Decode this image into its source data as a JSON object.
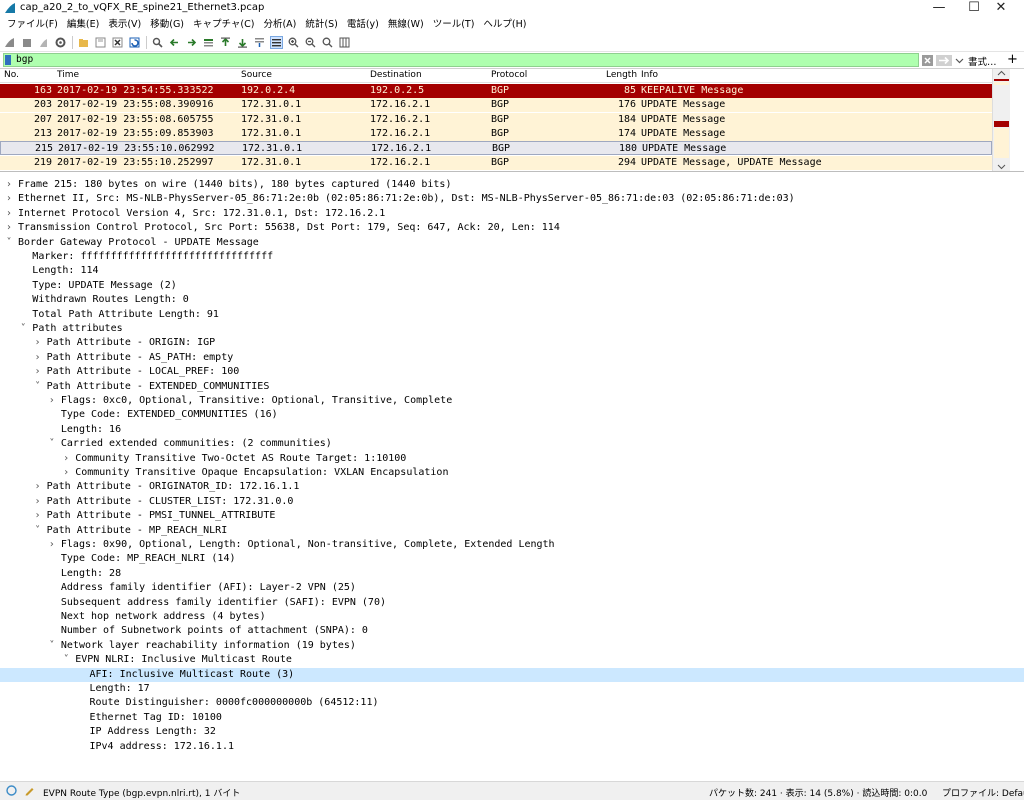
{
  "window": {
    "title": "cap_a20_2_to_vQFX_RE_spine21_Ethernet3.pcap",
    "minimize": "—",
    "maximize": "☐",
    "close": "✕"
  },
  "menu": [
    "ファイル(F)",
    "編集(E)",
    "表示(V)",
    "移動(G)",
    "キャプチャ(C)",
    "分析(A)",
    "統計(S)",
    "電話(y)",
    "無線(W)",
    "ツール(T)",
    "ヘルプ(H)"
  ],
  "toolbar": {
    "icons": [
      "shark-fin-icon",
      "stop-icon",
      "restart-icon",
      "options-gear-icon",
      "open-folder-icon",
      "save-icon",
      "close-file-icon",
      "reload-icon",
      "find-icon",
      "back-arrow-icon",
      "forward-arrow-icon",
      "goto-packet-icon",
      "first-packet-icon",
      "last-packet-icon",
      "autoscroll-icon",
      "colorize-icon",
      "zoom-in-icon",
      "zoom-out-icon",
      "normal-size-icon",
      "resize-columns-icon"
    ]
  },
  "filter": {
    "value": "bgp",
    "expression_label": "書式…",
    "add_label": "+"
  },
  "packet_list": {
    "columns": [
      "No.",
      "Time",
      "Source",
      "Destination",
      "Protocol",
      "Length",
      "Info"
    ],
    "rows": [
      {
        "no": "163",
        "time": "2017-02-19 23:54:55.333522",
        "src": "192.0.2.4",
        "dst": "192.0.2.5",
        "proto": "BGP",
        "len": "85",
        "info": "KEEPALIVE Message",
        "style": "keepalive"
      },
      {
        "no": "203",
        "time": "2017-02-19 23:55:08.390916",
        "src": "172.31.0.1",
        "dst": "172.16.2.1",
        "proto": "BGP",
        "len": "176",
        "info": "UPDATE Message",
        "style": "update"
      },
      {
        "no": "207",
        "time": "2017-02-19 23:55:08.605755",
        "src": "172.31.0.1",
        "dst": "172.16.2.1",
        "proto": "BGP",
        "len": "184",
        "info": "UPDATE Message",
        "style": "update"
      },
      {
        "no": "213",
        "time": "2017-02-19 23:55:09.853903",
        "src": "172.31.0.1",
        "dst": "172.16.2.1",
        "proto": "BGP",
        "len": "174",
        "info": "UPDATE Message",
        "style": "update"
      },
      {
        "no": "215",
        "time": "2017-02-19 23:55:10.062992",
        "src": "172.31.0.1",
        "dst": "172.16.2.1",
        "proto": "BGP",
        "len": "180",
        "info": "UPDATE Message",
        "style": "selected"
      },
      {
        "no": "219",
        "time": "2017-02-19 23:55:10.252997",
        "src": "172.31.0.1",
        "dst": "172.16.2.1",
        "proto": "BGP",
        "len": "294",
        "info": "UPDATE Message, UPDATE Message",
        "style": "update"
      }
    ]
  },
  "details": [
    {
      "level": 0,
      "arrow": ">",
      "text": "Frame 215: 180 bytes on wire (1440 bits), 180 bytes captured (1440 bits)"
    },
    {
      "level": 0,
      "arrow": ">",
      "text": "Ethernet II, Src: MS-NLB-PhysServer-05_86:71:2e:0b (02:05:86:71:2e:0b), Dst: MS-NLB-PhysServer-05_86:71:de:03 (02:05:86:71:de:03)"
    },
    {
      "level": 0,
      "arrow": ">",
      "text": "Internet Protocol Version 4, Src: 172.31.0.1, Dst: 172.16.2.1"
    },
    {
      "level": 0,
      "arrow": ">",
      "text": "Transmission Control Protocol, Src Port: 55638, Dst Port: 179, Seq: 647, Ack: 20, Len: 114"
    },
    {
      "level": 0,
      "arrow": "v",
      "text": "Border Gateway Protocol - UPDATE Message"
    },
    {
      "level": 1,
      "arrow": "",
      "text": "Marker: ffffffffffffffffffffffffffffffff"
    },
    {
      "level": 1,
      "arrow": "",
      "text": "Length: 114"
    },
    {
      "level": 1,
      "arrow": "",
      "text": "Type: UPDATE Message (2)"
    },
    {
      "level": 1,
      "arrow": "",
      "text": "Withdrawn Routes Length: 0"
    },
    {
      "level": 1,
      "arrow": "",
      "text": "Total Path Attribute Length: 91"
    },
    {
      "level": 1,
      "arrow": "v",
      "text": "Path attributes"
    },
    {
      "level": 2,
      "arrow": ">",
      "text": "Path Attribute - ORIGIN: IGP"
    },
    {
      "level": 2,
      "arrow": ">",
      "text": "Path Attribute - AS_PATH: empty"
    },
    {
      "level": 2,
      "arrow": ">",
      "text": "Path Attribute - LOCAL_PREF: 100"
    },
    {
      "level": 2,
      "arrow": "v",
      "text": "Path Attribute - EXTENDED_COMMUNITIES"
    },
    {
      "level": 3,
      "arrow": ">",
      "text": "Flags: 0xc0, Optional, Transitive: Optional, Transitive, Complete"
    },
    {
      "level": 3,
      "arrow": "",
      "text": "Type Code: EXTENDED_COMMUNITIES (16)"
    },
    {
      "level": 3,
      "arrow": "",
      "text": "Length: 16"
    },
    {
      "level": 3,
      "arrow": "v",
      "text": "Carried extended communities: (2 communities)"
    },
    {
      "level": 4,
      "arrow": ">",
      "text": "Community Transitive Two-Octet AS Route Target: 1:10100"
    },
    {
      "level": 4,
      "arrow": ">",
      "text": "Community Transitive Opaque Encapsulation: VXLAN Encapsulation"
    },
    {
      "level": 2,
      "arrow": ">",
      "text": "Path Attribute - ORIGINATOR_ID: 172.16.1.1"
    },
    {
      "level": 2,
      "arrow": ">",
      "text": "Path Attribute - CLUSTER_LIST: 172.31.0.0"
    },
    {
      "level": 2,
      "arrow": ">",
      "text": "Path Attribute - PMSI_TUNNEL_ATTRIBUTE"
    },
    {
      "level": 2,
      "arrow": "v",
      "text": "Path Attribute - MP_REACH_NLRI"
    },
    {
      "level": 3,
      "arrow": ">",
      "text": "Flags: 0x90, Optional, Length: Optional, Non-transitive, Complete, Extended Length"
    },
    {
      "level": 3,
      "arrow": "",
      "text": "Type Code: MP_REACH_NLRI (14)"
    },
    {
      "level": 3,
      "arrow": "",
      "text": "Length: 28"
    },
    {
      "level": 3,
      "arrow": "",
      "text": "Address family identifier (AFI): Layer-2 VPN (25)"
    },
    {
      "level": 3,
      "arrow": "",
      "text": "Subsequent address family identifier (SAFI): EVPN (70)"
    },
    {
      "level": 3,
      "arrow": "",
      "text": "Next hop network address (4 bytes)"
    },
    {
      "level": 3,
      "arrow": "",
      "text": "Number of Subnetwork points of attachment (SNPA): 0"
    },
    {
      "level": 3,
      "arrow": "v",
      "text": "Network layer reachability information (19 bytes)"
    },
    {
      "level": 4,
      "arrow": "v",
      "text": "EVPN NLRI: Inclusive Multicast Route"
    },
    {
      "level": 5,
      "arrow": "",
      "text": "AFI: Inclusive Multicast Route (3)",
      "selected": true
    },
    {
      "level": 5,
      "arrow": "",
      "text": "Length: 17"
    },
    {
      "level": 5,
      "arrow": "",
      "text": "Route Distinguisher: 0000fc000000000b (64512:11)"
    },
    {
      "level": 5,
      "arrow": "",
      "text": "Ethernet Tag ID: 10100"
    },
    {
      "level": 5,
      "arrow": "",
      "text": "IP Address Length: 32"
    },
    {
      "level": 5,
      "arrow": "",
      "text": "IPv4 address: 172.16.1.1"
    }
  ],
  "status": {
    "field_info": "EVPN Route Type (bgp.evpn.nlri.rt), 1 バイト",
    "packets": "パケット数: 241 · 表示: 14 (5.8%) · 読込時間: 0:0.0",
    "profile": "プロファイル: Default"
  },
  "colors": {
    "keepalive_bg": "#a40000",
    "keepalive_fg": "#fff3d6",
    "update_bg": "#fff3d6",
    "selected_bg": "#e8e8ee",
    "detail_selected_bg": "#cce8ff",
    "filter_bg": "#afffaf"
  }
}
